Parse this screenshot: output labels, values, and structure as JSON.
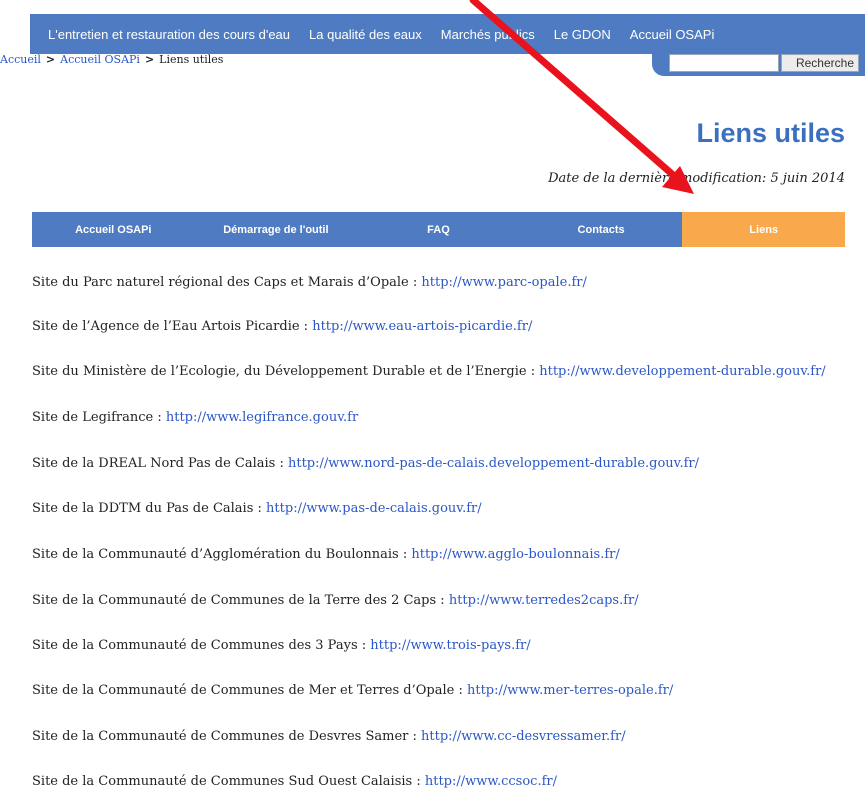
{
  "topnav": {
    "items": [
      "L'entretien et restauration des cours d'eau",
      "La qualité des eaux",
      "Marchés publics",
      "Le GDON",
      "Accueil OSAPi"
    ]
  },
  "search": {
    "placeholder": "",
    "button_label": "Recherche"
  },
  "breadcrumb": {
    "items": [
      "Accueil",
      "Accueil OSAPi",
      "Liens utiles"
    ],
    "separator": ">"
  },
  "page": {
    "title": "Liens utiles",
    "modified": "Date de la dernière modification: 5 juin 2014"
  },
  "tabs": [
    {
      "label": "Accueil OSAPi",
      "active": false
    },
    {
      "label": "Démarrage de l'outil",
      "active": false
    },
    {
      "label": "FAQ",
      "active": false
    },
    {
      "label": "Contacts",
      "active": false
    },
    {
      "label": "Liens",
      "active": true
    }
  ],
  "links": [
    {
      "label": "Site du Parc naturel régional des Caps et Marais d’Opale : ",
      "url": "http://www.parc-opale.fr/"
    },
    {
      "label": "Site de l’Agence de l’Eau Artois Picardie : ",
      "url": "http://www.eau-artois-picardie.fr/"
    },
    {
      "label": "Site du Ministère de l’Ecologie, du Développement Durable et de l’Energie : ",
      "url": "http://www.developpement-durable.gouv.fr/"
    },
    {
      "label": "Site de Legifrance : ",
      "url": "http://www.legifrance.gouv.fr"
    },
    {
      "label": "Site de la DREAL Nord Pas de Calais : ",
      "url": "http://www.nord-pas-de-calais.developpement-durable.gouv.fr/"
    },
    {
      "label": "Site de la DDTM du Pas de Calais : ",
      "url": "http://www.pas-de-calais.gouv.fr/"
    },
    {
      "label": "Site de la Communauté d’Agglomération du Boulonnais : ",
      "url": "http://www.agglo-boulonnais.fr/"
    },
    {
      "label": "Site de la Communauté de Communes de la Terre des 2 Caps : ",
      "url": "http://www.terredes2caps.fr/"
    },
    {
      "label": "Site de la Communauté de Communes des 3 Pays : ",
      "url": "http://www.trois-pays.fr/"
    },
    {
      "label": "Site de la Communauté de Communes de Mer et Terres d’Opale : ",
      "url": "http://www.mer-terres-opale.fr/"
    },
    {
      "label": "Site de la Communauté de Communes de Desvres Samer : ",
      "url": "http://www.cc-desvressamer.fr/"
    },
    {
      "label": "Site de la Communauté de Communes Sud Ouest Calaisis : ",
      "url": "http://www.ccsoc.fr/"
    }
  ],
  "annotation": {
    "arrow_color": "#e8131c"
  }
}
